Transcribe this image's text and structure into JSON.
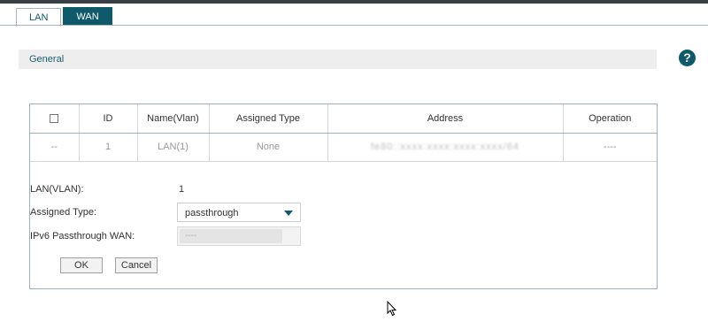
{
  "tabs": [
    {
      "label": "LAN",
      "active": true
    },
    {
      "label": "WAN",
      "active": false
    }
  ],
  "section": {
    "title": "General",
    "help_icon": "question-circle-icon",
    "help_label": "?"
  },
  "table": {
    "columns": [
      "",
      "ID",
      "Name(Vlan)",
      "Assigned Type",
      "Address",
      "Operation"
    ],
    "rows": [
      {
        "select": "--",
        "id": "1",
        "name": "LAN(1)",
        "assigned_type": "None",
        "address": "fe80::xxxx:xxxx:xxxx:xxxx/64",
        "operation": "----"
      }
    ]
  },
  "edit_form": {
    "lan_label": "LAN(VLAN):",
    "lan_value": "1",
    "assigned_type_label": "Assigned Type:",
    "assigned_type_value": "passthrough",
    "passthrough_wan_label": "IPv6 Passthrough WAN:",
    "passthrough_wan_value": "----",
    "ok_label": "OK",
    "cancel_label": "Cancel"
  },
  "colors": {
    "accent": "#0e5a6b",
    "section_bg": "#eeeeee",
    "border": "#9fb0b9"
  }
}
